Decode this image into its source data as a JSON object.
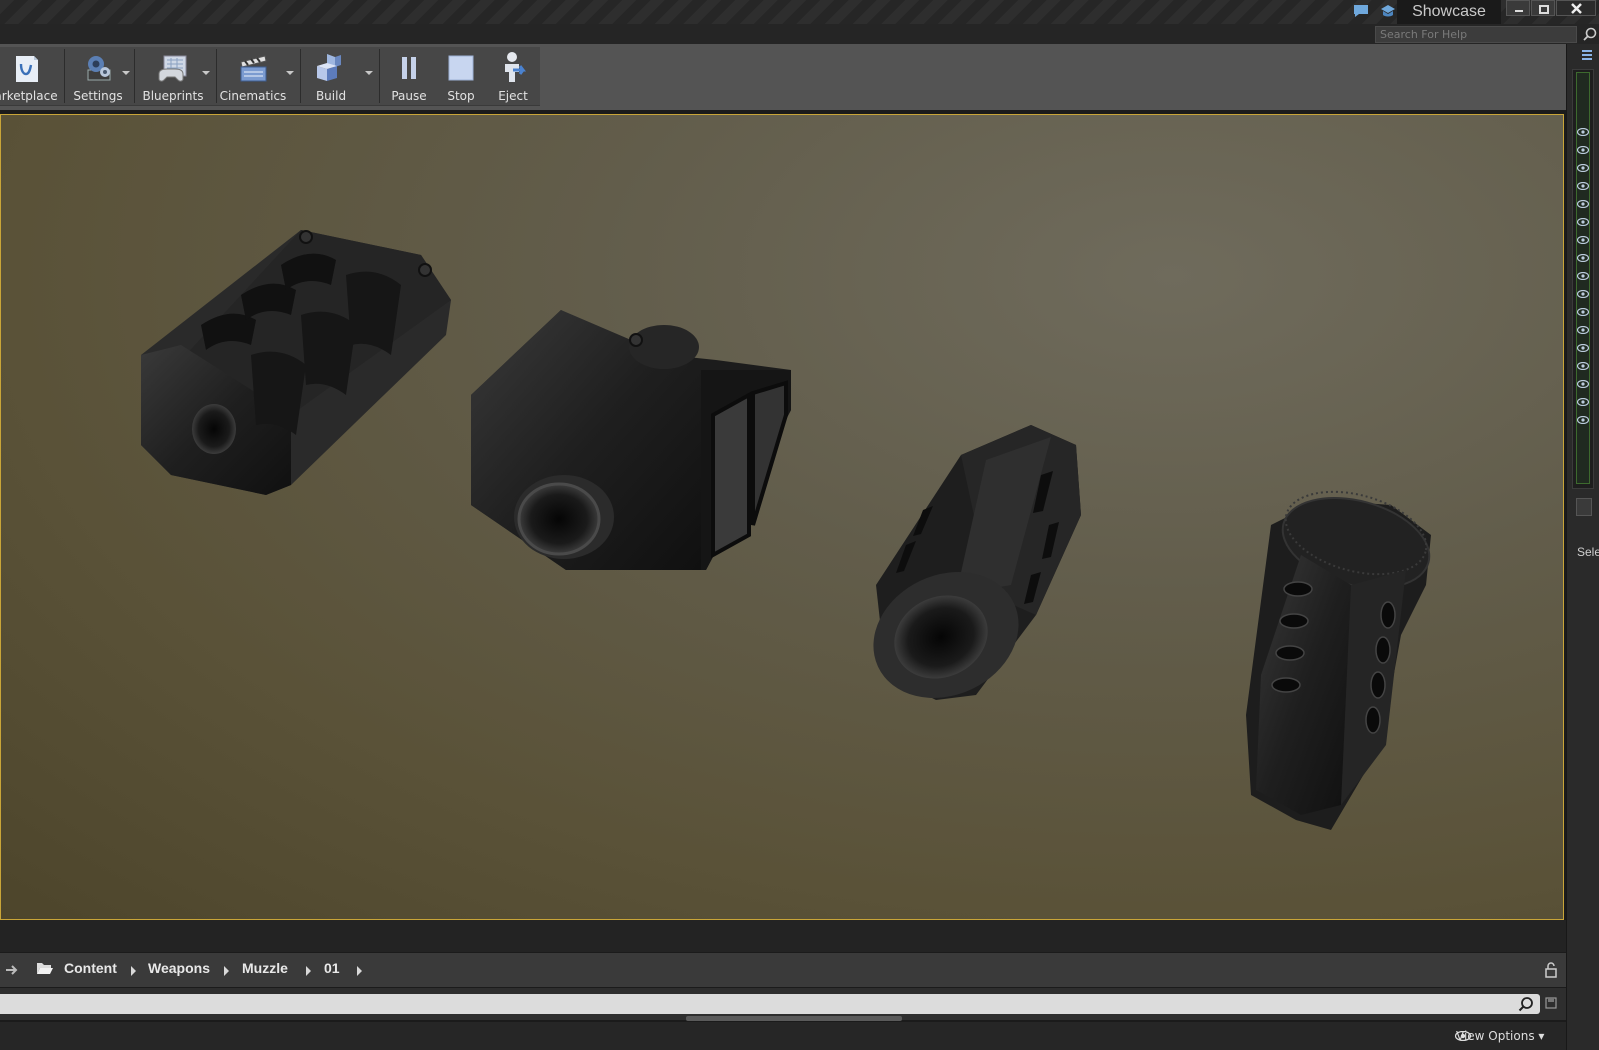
{
  "title_bar": {
    "project_name": "Showcase",
    "window_controls": [
      "minimize-icon",
      "restore-icon",
      "close-icon"
    ]
  },
  "help": {
    "search_placeholder": "Search For Help"
  },
  "toolbar": {
    "buttons": [
      {
        "label": "arketplace",
        "icon": "marketplace-icon",
        "dropdown": false
      },
      {
        "label": "Settings",
        "icon": "settings-icon",
        "dropdown": true
      },
      {
        "label": "Blueprints",
        "icon": "blueprints-icon",
        "dropdown": true
      },
      {
        "label": "Cinematics",
        "icon": "cinematics-icon",
        "dropdown": true
      },
      {
        "label": "Build",
        "icon": "build-icon",
        "dropdown": true
      },
      {
        "label": "Pause",
        "icon": "pause-icon",
        "dropdown": false
      },
      {
        "label": "Stop",
        "icon": "stop-icon",
        "dropdown": false
      },
      {
        "label": "Eject",
        "icon": "eject-icon",
        "dropdown": false
      }
    ]
  },
  "viewport": {
    "scene_objects": [
      "muzzle-brake-slotted",
      "muzzle-brake-boxed",
      "muzzle-brake-hex",
      "muzzle-brake-threaded"
    ],
    "border_color": "#c9a538"
  },
  "right_panel": {
    "details_label": "Sele"
  },
  "content_browser": {
    "path": [
      "Content",
      "Weapons",
      "Muzzle",
      "01"
    ],
    "search_value": "",
    "view_options_label": "View Options"
  }
}
